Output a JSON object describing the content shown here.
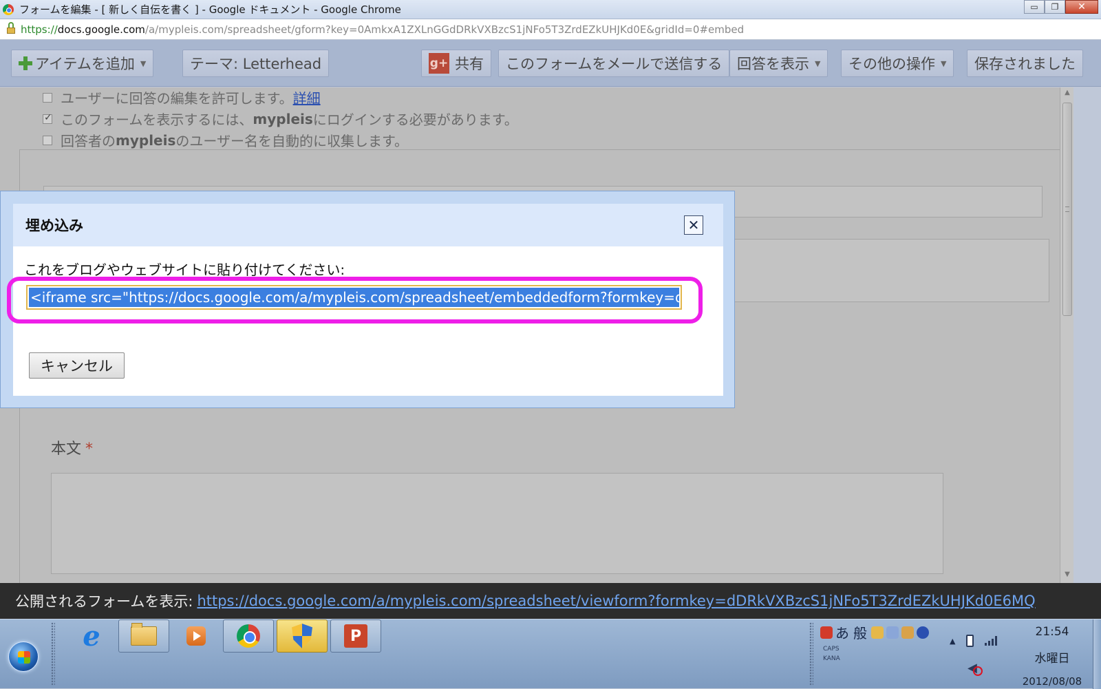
{
  "window": {
    "title": "フォームを編集 - [ 新しく自伝を書く ] - Google ドキュメント - Google Chrome",
    "buttons": {
      "minimize": "▭",
      "restore": "❐",
      "close": "✕"
    }
  },
  "address": {
    "scheme": "https://",
    "host": "docs.google.com",
    "path": "/a/mypleis.com/spreadsheet/gform?key=0AmkxA1ZXLnGGdDRkVXBzcS1jNFo5T3ZrdEZkUHJKd0E&gridId=0#embed"
  },
  "toolbar": {
    "add_item": "アイテムを追加",
    "theme": "テーマ:  Letterhead",
    "share_icon_text": "g+",
    "share": "共有",
    "email_form": "このフォームをメールで送信する",
    "view_responses": "回答を表示",
    "more_actions": "その他の操作",
    "saved": "保存されました",
    "caret": "▼"
  },
  "settings": {
    "allow_edit": "ユーザーに回答の編集を許可します。",
    "allow_edit_link": "詳細",
    "require_login_prefix": "このフォームを表示するには、",
    "require_login_domain": "mypleis",
    "require_login_suffix": " にログインする必要があります。",
    "collect_prefix": "回答者の ",
    "collect_domain": "mypleis",
    "collect_suffix": " のユーザー名を自動的に収集します。"
  },
  "form": {
    "body_label": "本文",
    "required_mark": "*"
  },
  "modal": {
    "title": "埋め込み",
    "close": "✕",
    "instruction": "これをブログやウェブサイトに貼り付けてください:",
    "embed_code": "<iframe src=\"https://docs.google.com/a/mypleis.com/spreadsheet/embeddedform?formkey=dDRk",
    "cancel": "キャンセル"
  },
  "public_bar": {
    "label": "公開されるフォームを表示:",
    "url": "https://docs.google.com/a/mypleis.com/spreadsheet/viewform?formkey=dDRkVXBzcS1jNFo5T3ZrdEZkUHJKd0E6MQ"
  },
  "taskbar": {
    "ie_glyph": "e",
    "ppt_glyph": "P",
    "ime_mode": "あ",
    "ime_type": "般",
    "caps": "CAPS",
    "kana": "KANA",
    "clock": {
      "time": "21:54",
      "day": "水曜日",
      "date": "2012/08/08"
    }
  },
  "colors": {
    "highlight_border": "#ee1fe8",
    "selection": "#3b7fe0",
    "link": "#6fa4ef"
  },
  "icons": [
    "chrome-icon",
    "lock-icon",
    "plus-icon",
    "google-plus-icon",
    "close-icon",
    "windows-start-icon",
    "internet-explorer-icon",
    "folder-icon",
    "media-player-icon",
    "chrome-icon",
    "security-shield-icon",
    "powerpoint-icon",
    "battery-icon",
    "signal-icon",
    "speaker-muted-icon"
  ]
}
